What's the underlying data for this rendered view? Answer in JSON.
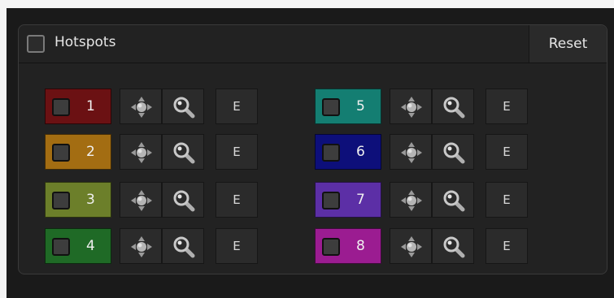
{
  "header": {
    "title": "Hotspots",
    "reset_label": "Reset"
  },
  "hotspots": [
    {
      "number": "1",
      "color": "#6b1113",
      "edit_label": "E"
    },
    {
      "number": "2",
      "color": "#a36d12",
      "edit_label": "E"
    },
    {
      "number": "3",
      "color": "#6c7f2a",
      "edit_label": "E"
    },
    {
      "number": "4",
      "color": "#1f6a26",
      "edit_label": "E"
    },
    {
      "number": "5",
      "color": "#147e72",
      "edit_label": "E"
    },
    {
      "number": "6",
      "color": "#0d0f7a",
      "edit_label": "E"
    },
    {
      "number": "7",
      "color": "#5c2fa6",
      "edit_label": "E"
    },
    {
      "number": "8",
      "color": "#9b1c91",
      "edit_label": "E"
    }
  ],
  "icons": {
    "move": "move-arrows-icon",
    "zoom": "magnifier-icon"
  }
}
